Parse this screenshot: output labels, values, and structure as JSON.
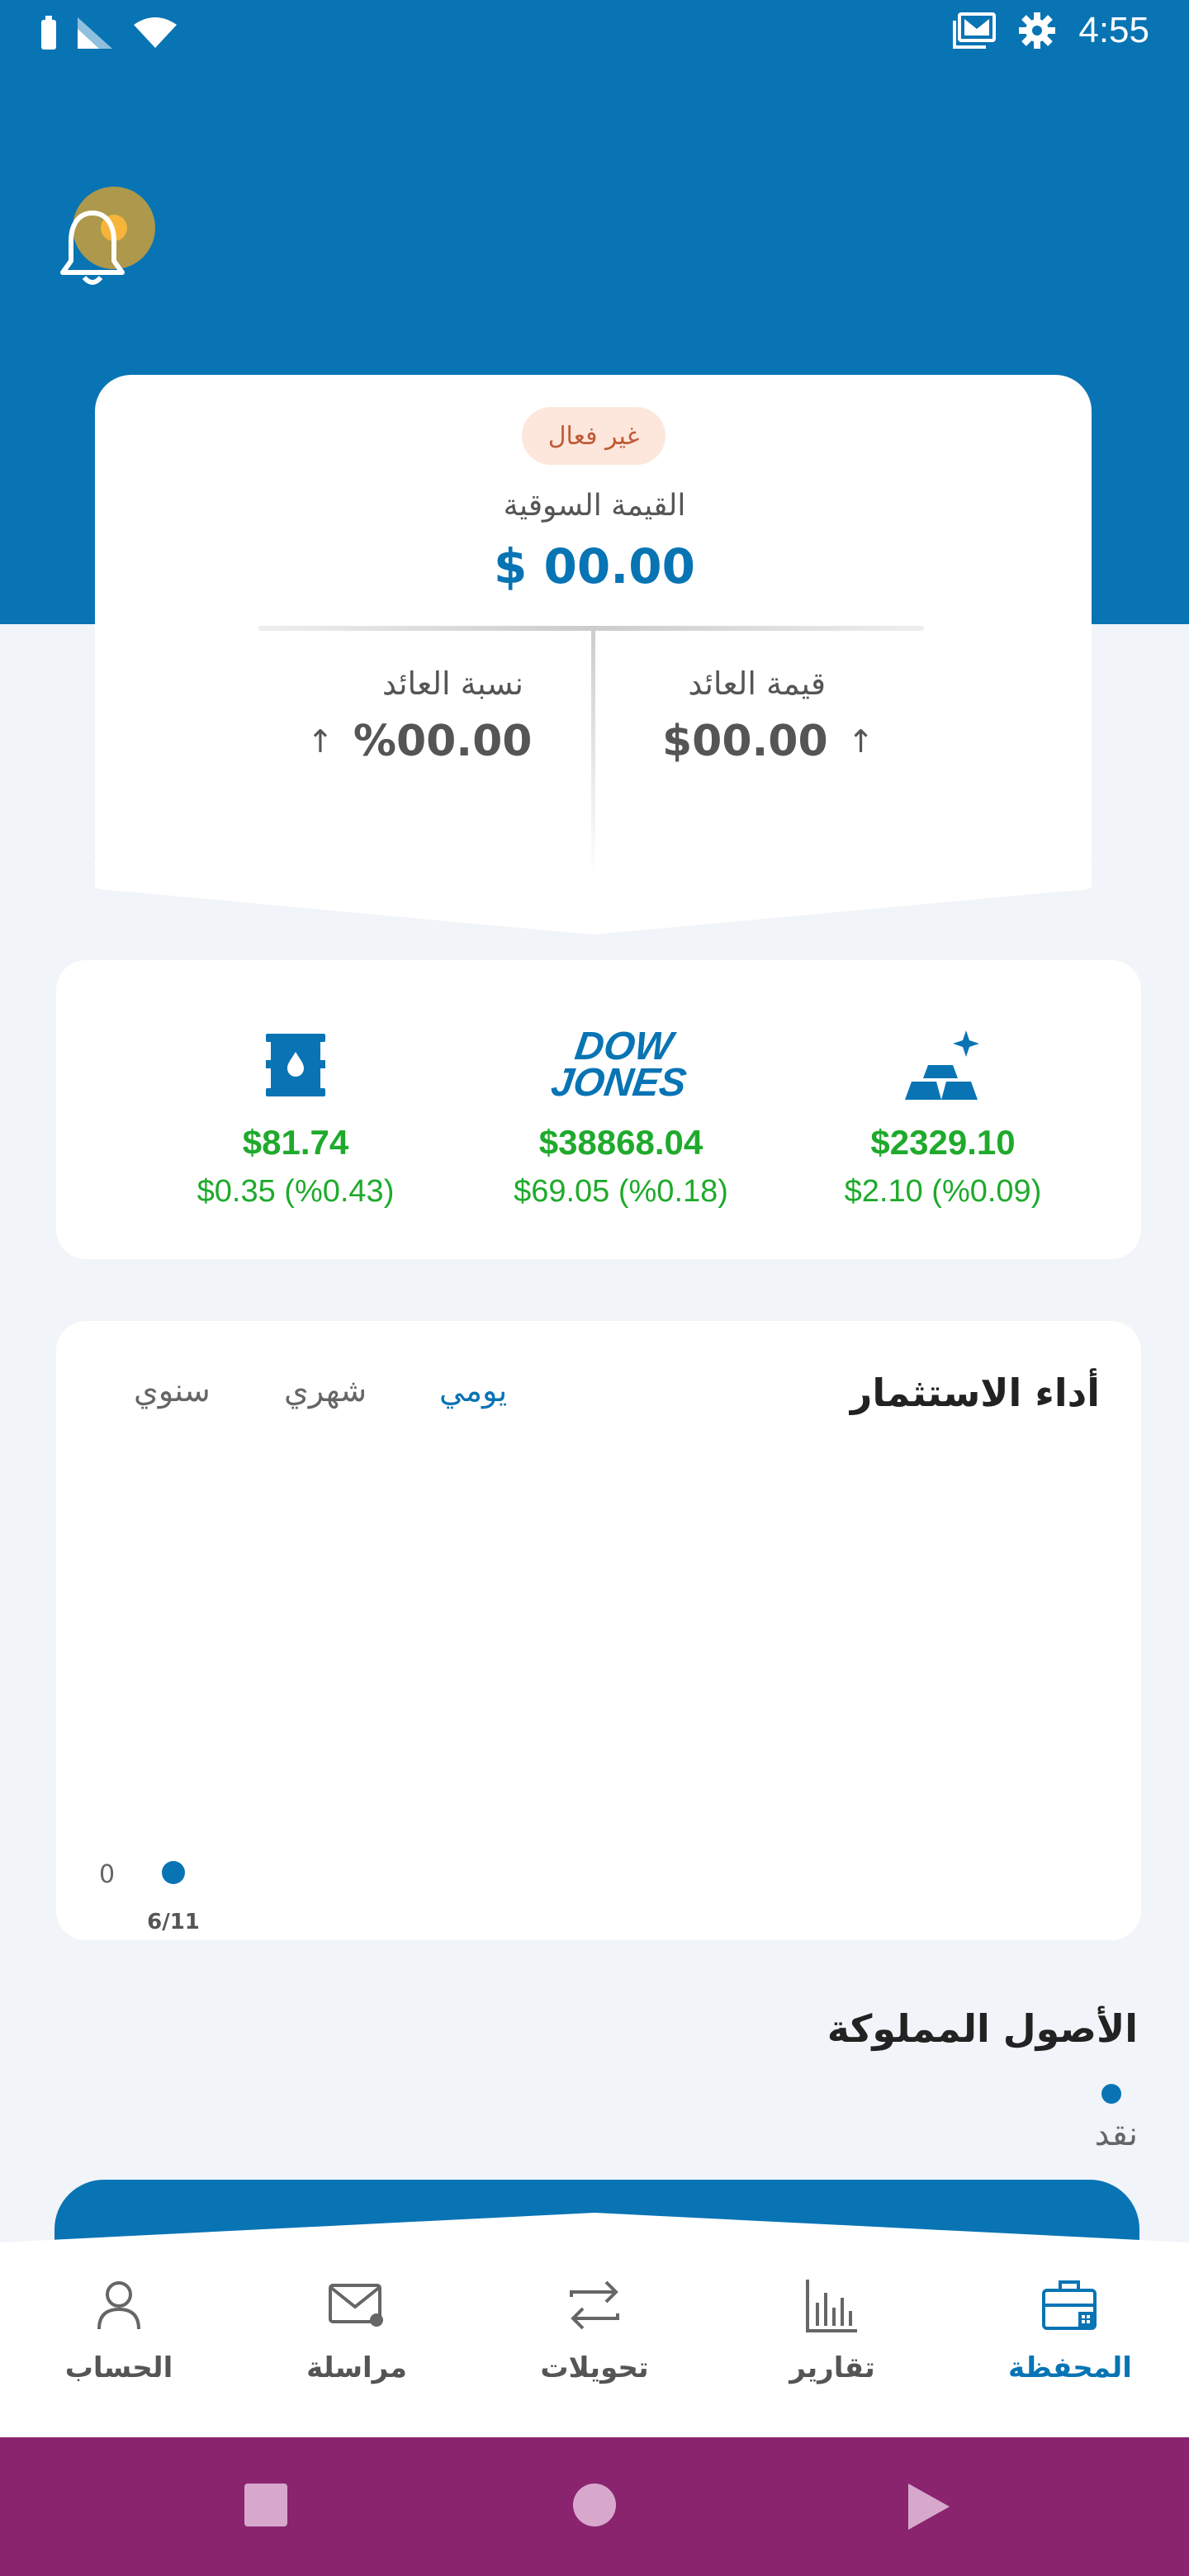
{
  "status_bar": {
    "time": "4:55",
    "left_icons": [
      "battery-icon",
      "signal-icon",
      "wifi-icon"
    ],
    "right_icons": [
      "gmail-icon",
      "settings-icon"
    ]
  },
  "header": {
    "notification_icon": "bell-icon"
  },
  "portfolio": {
    "status_badge": "غير فعال",
    "market_value_label": "القيمة السوقية",
    "market_value": "$ 00.00",
    "return_value_label": "قيمة العائد",
    "return_value": "$00.00",
    "return_percent_label": "نسبة العائد",
    "return_percent": "%00.00",
    "return_arrow": "↑"
  },
  "tickers": [
    {
      "name": "gold",
      "icon": "gold-bars-icon",
      "price": "$2329.10",
      "change": "$2.10 (%0.09)"
    },
    {
      "name": "dow-jones",
      "icon": "dow-jones-logo",
      "logo_line1": "DOW",
      "logo_line2": "JONES",
      "price": "$38868.04",
      "change": "$69.05 (%0.18)"
    },
    {
      "name": "oil",
      "icon": "oil-barrel-icon",
      "price": "$81.74",
      "change": "$0.35 (%0.43)"
    }
  ],
  "performance": {
    "title": "أداء الاستثمار",
    "tabs": [
      {
        "label": "يومي",
        "active": true
      },
      {
        "label": "شهري",
        "active": false
      },
      {
        "label": "سنوي",
        "active": false
      }
    ]
  },
  "chart_data": {
    "type": "scatter",
    "title": "أداء الاستثمار",
    "x": [
      "6/11"
    ],
    "values": [
      0
    ],
    "y_tick_labels": [
      "0"
    ],
    "series_color": "#0874b4",
    "grid": false
  },
  "assets": {
    "title": "الأصول المملوكة",
    "legend": [
      {
        "label": "نقد",
        "color": "#0874b4"
      }
    ]
  },
  "bottom_nav": [
    {
      "key": "account",
      "label": "الحساب",
      "icon": "person-icon",
      "active": false
    },
    {
      "key": "messages",
      "label": "مراسلة",
      "icon": "mail-icon",
      "active": false
    },
    {
      "key": "transfers",
      "label": "تحويلات",
      "icon": "transfer-icon",
      "active": false
    },
    {
      "key": "reports",
      "label": "تقارير",
      "icon": "bar-chart-icon",
      "active": false
    },
    {
      "key": "portfolio",
      "label": "المحفظة",
      "icon": "briefcase-icon",
      "active": true
    }
  ],
  "colors": {
    "primary": "#0874b4",
    "positive": "#1faa2c",
    "badge_bg": "#fde6dc",
    "system_nav": "#8a246f"
  }
}
